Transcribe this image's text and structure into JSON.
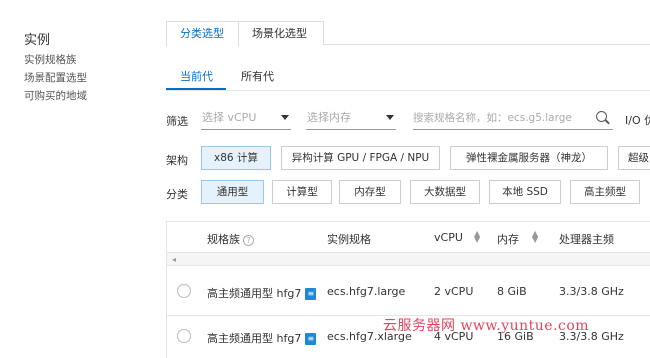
{
  "sidebar": {
    "title": "实例",
    "items": [
      {
        "label": "实例规格族"
      },
      {
        "label": "场景配置选型"
      },
      {
        "label": "可购买的地域"
      }
    ]
  },
  "tabs": [
    {
      "label": "分类选型",
      "active": true
    },
    {
      "label": "场景化选型",
      "active": false
    }
  ],
  "subtabs": [
    {
      "label": "当前代",
      "active": true
    },
    {
      "label": "所有代",
      "active": false
    }
  ],
  "filter": {
    "label": "筛选",
    "vcpu_placeholder": "选择 vCPU",
    "memory_placeholder": "选择内存",
    "search_placeholder": "搜索规格名称，如：ecs.g5.large",
    "io_label": "I/O 优"
  },
  "arch": {
    "label": "架构",
    "options": [
      {
        "label": "x86 计算",
        "active": true
      },
      {
        "label": "异构计算 GPU / FPGA / NPU",
        "active": false
      },
      {
        "label": "弹性裸金属服务器（神龙）",
        "active": false
      },
      {
        "label": "超级",
        "active": false
      }
    ]
  },
  "category": {
    "label": "分类",
    "options": [
      {
        "label": "通用型",
        "active": true
      },
      {
        "label": "计算型",
        "active": false
      },
      {
        "label": "内存型",
        "active": false
      },
      {
        "label": "大数据型",
        "active": false
      },
      {
        "label": "本地 SSD",
        "active": false
      },
      {
        "label": "高主频型",
        "active": false
      }
    ]
  },
  "table": {
    "headers": {
      "family": "规格族",
      "spec": "实例规格",
      "vcpu": "vCPU",
      "memory": "内存",
      "cpu": "处理器主频"
    },
    "rows": [
      {
        "family": "高主频通用型 hfg7",
        "spec": "ecs.hfg7.large",
        "vcpu": "2 vCPU",
        "memory": "8 GiB",
        "cpu": "3.3/3.8 GHz"
      },
      {
        "family": "高主频通用型 hfg7",
        "spec": "ecs.hfg7.xlarge",
        "vcpu": "4 vCPU",
        "memory": "16 GiB",
        "cpu": "3.3/3.8 GHz"
      }
    ]
  },
  "watermark": "云服务器网 www.yuntue.com",
  "colors": {
    "accent": "#0070cc",
    "chip_active_bg": "#e6f2fb",
    "badge": "#1e88d6",
    "watermark": "#e0455f"
  },
  "icons": [
    "search-icon",
    "help-icon",
    "sort-icon",
    "caret-down-icon",
    "scroll-left-icon",
    "family-badge-icon"
  ]
}
